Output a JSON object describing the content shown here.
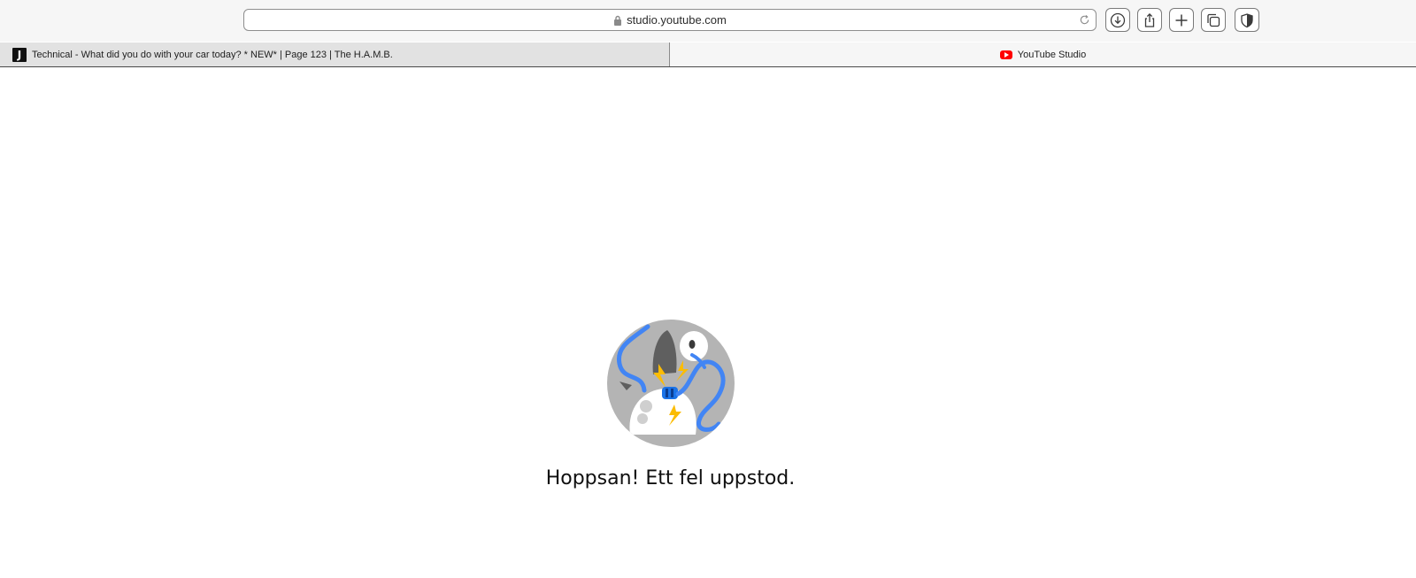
{
  "browser": {
    "address": "studio.youtube.com",
    "buttons": [
      "download",
      "share",
      "new-tab",
      "tab-overview",
      "privacy"
    ]
  },
  "tabs": [
    {
      "favicon": "J",
      "label": "Technical - What did you do with your car today? * NEW* | Page 123 | The H.A.M.B."
    },
    {
      "favicon": "youtube-icon",
      "label": "YouTube Studio"
    }
  ],
  "page": {
    "error_message": "Hoppsan! Ett fel uppstod."
  },
  "colors": {
    "youtube_red": "#ff0000",
    "cable_blue": "#4285f4",
    "spark_yellow": "#fbbc04",
    "illustration_gray": "#b4b4b4"
  }
}
